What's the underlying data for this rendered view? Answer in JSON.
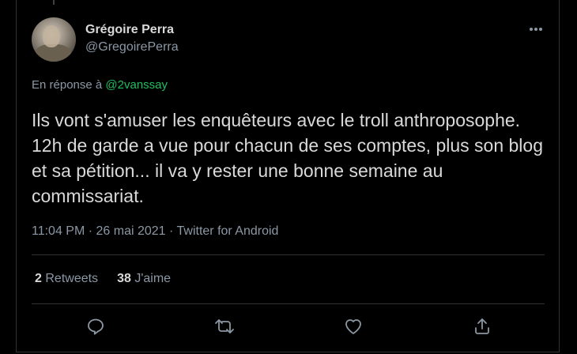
{
  "tweet": {
    "author_name": "Grégoire Perra",
    "author_handle": "@GregoirePerra",
    "reply_prefix": "En réponse à",
    "reply_mention": "@2vanssay",
    "text": "Ils vont s'amuser les enquêteurs avec le troll anthroposophe. 12h de garde a vue pour chacun de ses comptes, plus son blog et sa pétition... il va y rester une bonne semaine au commissariat.",
    "meta": "11:04 PM · 26 mai 2021 · Twitter for Android"
  },
  "stats": {
    "retweets_count": "2",
    "retweets_label": "Retweets",
    "likes_count": "38",
    "likes_label": "J'aime"
  },
  "icons": {
    "more": "more-horizontal-icon",
    "reply": "reply-bubble-icon",
    "retweet": "retweet-icon",
    "like": "heart-icon",
    "share": "share-icon"
  },
  "colors": {
    "background": "#000000",
    "text": "#d9d9d9",
    "muted": "#8b98a5",
    "mention": "#1fbf5f",
    "border": "#2f3336"
  }
}
